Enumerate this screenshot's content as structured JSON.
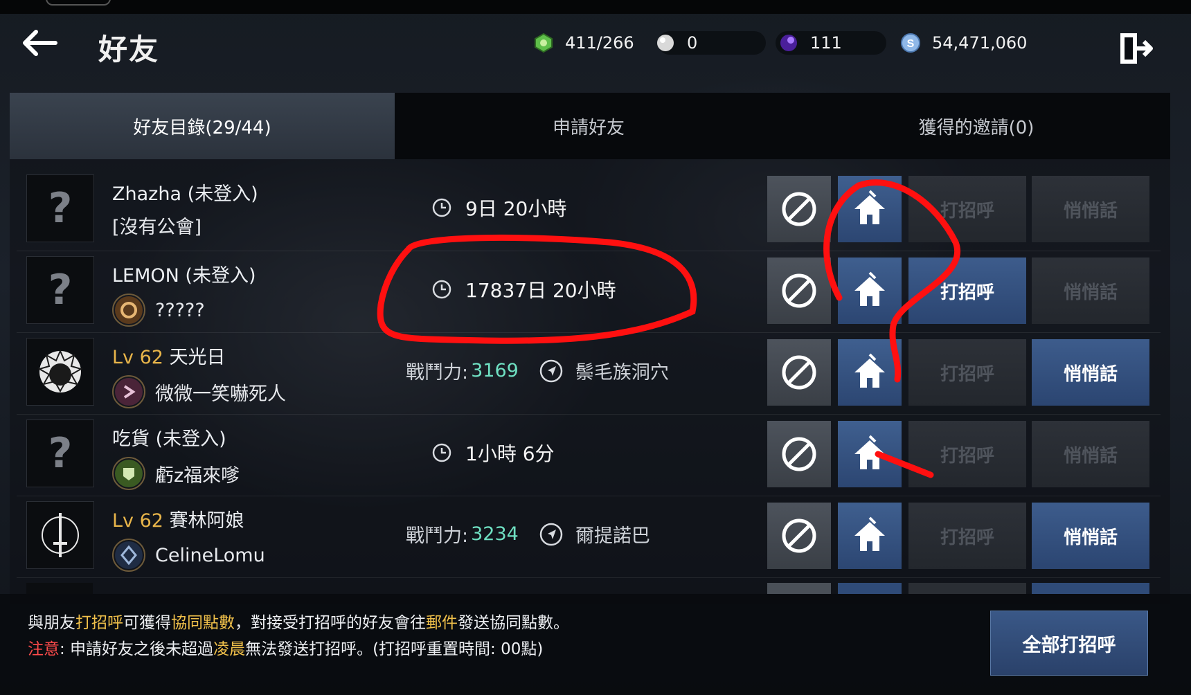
{
  "header": {
    "title": "好友",
    "resources": [
      {
        "icon": "stamina-icon",
        "value": "411/266",
        "color": "#5fbf4a"
      },
      {
        "icon": "pearl-icon",
        "value": "0",
        "color": "#d9d9d9"
      },
      {
        "icon": "crystal-icon",
        "value": "111",
        "color": "#7a3fd1"
      },
      {
        "icon": "silver-coin-icon",
        "value": "54,471,060",
        "color": "#8fb8e8"
      }
    ]
  },
  "tabs": [
    {
      "label": "好友目錄(29/44)",
      "active": true
    },
    {
      "label": "申請好友",
      "active": false
    },
    {
      "label": "獲得的邀請(0)",
      "active": false
    }
  ],
  "friends": [
    {
      "level": "",
      "name": "Zhazha (未登入)",
      "guild": "[沒有公會]",
      "status": "9日 20小時",
      "power_label": "",
      "power": "",
      "location": "",
      "hello": "打招呼",
      "hello_on": false,
      "whisper": "悄悄話",
      "whisper_on": false
    },
    {
      "level": "",
      "name": "LEMON (未登入)",
      "guild": "?????",
      "status": "17837日 20小時",
      "power_label": "",
      "power": "",
      "location": "",
      "hello": "打招呼",
      "hello_on": true,
      "whisper": "悄悄話",
      "whisper_on": false
    },
    {
      "level": "Lv 62",
      "name": "天光日",
      "guild": "微微一笑嚇死人",
      "status": "",
      "power_label": "戰鬥力:",
      "power": "3169",
      "location": "鬃毛族洞穴",
      "hello": "打招呼",
      "hello_on": false,
      "whisper": "悄悄話",
      "whisper_on": true
    },
    {
      "level": "",
      "name": "吃貨 (未登入)",
      "guild": "虧z福來嗲",
      "status": "1小時 6分",
      "power_label": "",
      "power": "",
      "location": "",
      "hello": "打招呼",
      "hello_on": false,
      "whisper": "悄悄話",
      "whisper_on": false
    },
    {
      "level": "Lv 62",
      "name": "賽林阿娘",
      "guild": "CelineLomu",
      "status": "",
      "power_label": "戰鬥力:",
      "power": "3234",
      "location": "爾提諾巴",
      "hello": "打招呼",
      "hello_on": false,
      "whisper": "悄悄話",
      "whisper_on": true
    }
  ],
  "footer": {
    "line1": [
      "與朋友",
      "打招呼",
      "可獲得",
      "協同點數",
      "，對接受打招呼的好友會往",
      "郵件",
      "發送協同點數。"
    ],
    "line2": [
      "注意",
      ": 申請好友之後未超過",
      "凌晨",
      "無法發送打招呼。(打招呼重置時間: 00點)"
    ],
    "greet_all": "全部打招呼"
  },
  "colors": {
    "accent_blue": "#2e4b78",
    "highlight_yellow": "#f0c04a",
    "highlight_red": "#ff4b4b",
    "power_green": "#6fe0c2",
    "level_gold": "#e8b54a",
    "annotation_red": "#ff1010"
  }
}
